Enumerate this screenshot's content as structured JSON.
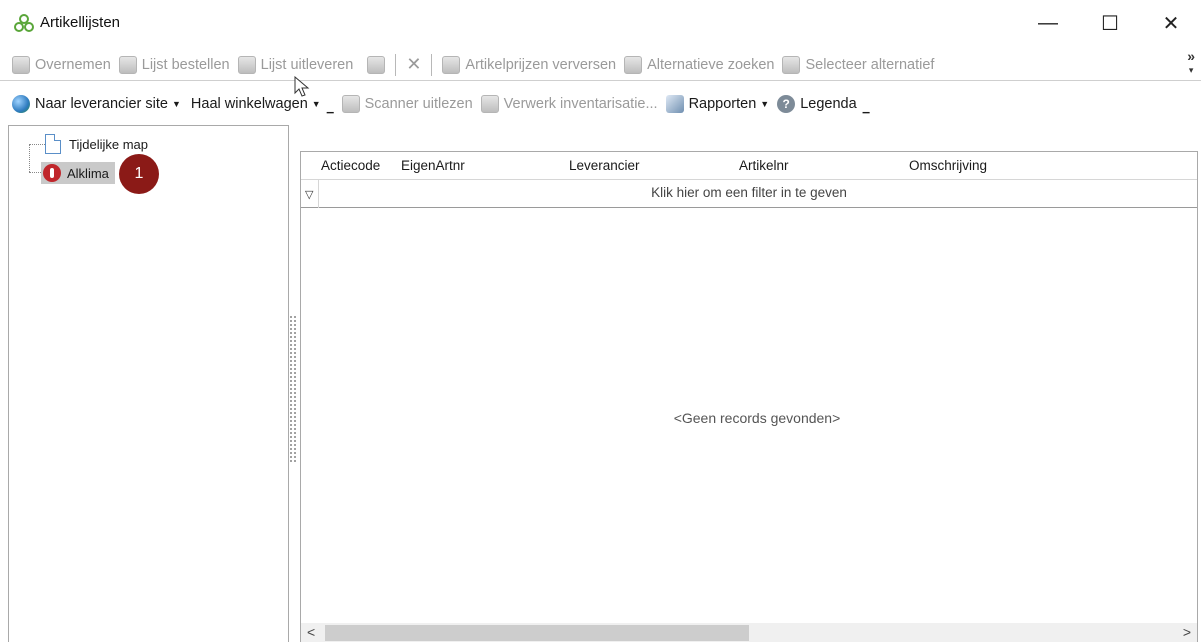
{
  "window": {
    "title": "Artikellijsten",
    "minimize": "—",
    "maximize": "☐",
    "close": "✕"
  },
  "toolbar1": {
    "items": [
      {
        "label": "Overnemen",
        "icon": "take-over-icon",
        "enabled": false
      },
      {
        "label": "Lijst bestellen",
        "icon": "order-list-icon",
        "enabled": false
      },
      {
        "label": "Lijst uitleveren",
        "icon": "deliver-list-icon",
        "enabled": false
      },
      {
        "label": "Artikelprijzen verversen",
        "icon": "refresh-prices-icon",
        "enabled": false
      },
      {
        "label": "Alternatieve zoeken",
        "icon": "search-alternative-icon",
        "enabled": false
      },
      {
        "label": "Selecteer alternatief",
        "icon": "select-alternative-icon",
        "enabled": false
      }
    ],
    "overflow": "»"
  },
  "toolbar2": {
    "items": [
      {
        "label": "Naar leverancier site",
        "icon": "globe-icon",
        "dropdown": true,
        "enabled": true
      },
      {
        "label": "Haal winkelwagen",
        "dropdown": true,
        "enabled": true
      },
      {
        "label": "Scanner uitlezen",
        "icon": "scanner-icon",
        "enabled": false
      },
      {
        "label": "Verwerk inventarisatie...",
        "icon": "inventory-icon",
        "enabled": false
      },
      {
        "label": "Rapporten",
        "icon": "reports-icon",
        "dropdown": true,
        "enabled": true
      },
      {
        "label": "Legenda",
        "icon": "help-icon",
        "enabled": true
      }
    ]
  },
  "tree": {
    "items": [
      {
        "label": "Tijdelijke map"
      },
      {
        "label": "Alklima",
        "selected": true
      }
    ],
    "badge": "1"
  },
  "grid": {
    "columns": [
      "Actiecode",
      "EigenArtnr",
      "Leverancier",
      "Artikelnr",
      "Omschrijving"
    ],
    "filter_hint": "Klik hier om een filter in te geven",
    "empty_message": "<Geen records gevonden>",
    "scroll_left": "<",
    "scroll_right": ">"
  },
  "colors": {
    "badge": "#8b1a17",
    "selection": "#c9c9c9",
    "disabled_text": "#9a9a9a"
  }
}
